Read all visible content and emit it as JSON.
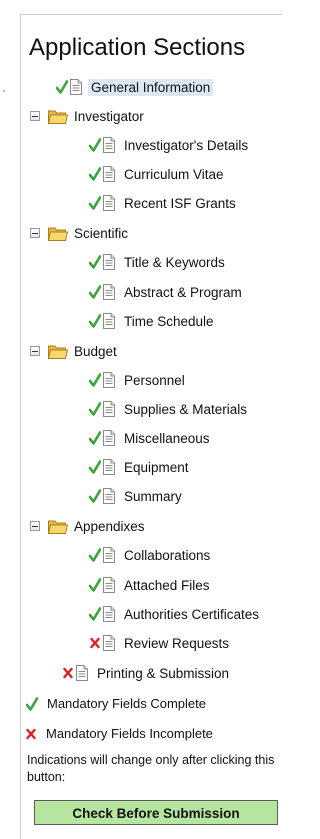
{
  "title": "Application Sections",
  "tree": {
    "general": "General Information",
    "investigator": {
      "label": "Investigator",
      "items": [
        "Investigator's Details",
        "Curriculum Vitae",
        "Recent ISF Grants"
      ]
    },
    "scientific": {
      "label": "Scientific",
      "items": [
        "Title & Keywords",
        "Abstract & Program",
        "Time Schedule"
      ]
    },
    "budget": {
      "label": "Budget",
      "items": [
        "Personnel",
        "Supplies & Materials",
        "Miscellaneous",
        "Equipment",
        "Summary"
      ]
    },
    "appendixes": {
      "label": "Appendixes",
      "items": [
        "Collaborations",
        "Attached Files",
        "Authorities Certificates",
        "Review Requests"
      ]
    },
    "printing": "Printing & Submission"
  },
  "legend": {
    "complete": "Mandatory Fields Complete",
    "incomplete": "Mandatory Fields Incomplete"
  },
  "note": "Indications will change only after clicking this button:",
  "button": "Check Before Submission",
  "colors": {
    "check": "#3aa53a",
    "cross": "#e02020",
    "folder": "#f3cf5a",
    "selected": "#dce9f4",
    "button": "#b5e59e"
  },
  "icons": {
    "complete": "green-check-icon",
    "incomplete": "red-x-icon",
    "page": "document-icon",
    "group": "folder-icon",
    "collapse": "minus-toggle-icon"
  }
}
